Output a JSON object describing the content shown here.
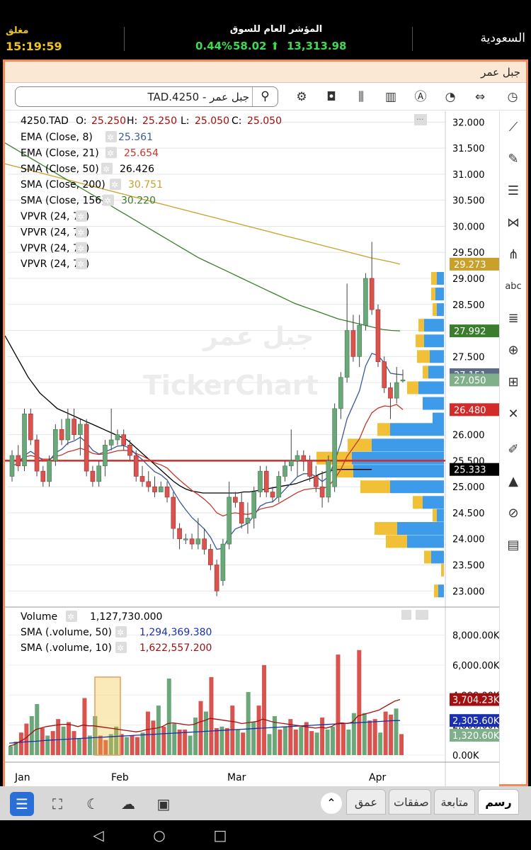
{
  "ticker": {
    "status": "مغلق",
    "time": "15:19:59",
    "index_title": "المؤشر العام للسوق",
    "change_pct": "0.44%",
    "change_pts": "58.02",
    "index_value": "13,313.98",
    "market": "السعودية"
  },
  "header": {
    "company": "جبل عمر"
  },
  "search": {
    "value": "TAD.4250 - جبل عمر"
  },
  "watermark": {
    "company": "جبل عمر",
    "brand": "TickerChart"
  },
  "legend": {
    "ohlc": {
      "symbol": "4250.TAD",
      "o_label": "O:",
      "o": "25.250",
      "h_label": "H:",
      "h": "25.250",
      "l_label": "L:",
      "l": "25.050",
      "c_label": "C:",
      "c": "25.050"
    },
    "indicators": [
      {
        "label": "EMA (Close, 8)",
        "value": "25.361",
        "color": "#3b5998"
      },
      {
        "label": "EMA (Close, 21)",
        "value": "25.654",
        "color": "#c0392b"
      },
      {
        "label": "SMA (Close, 50)",
        "value": "26.426",
        "color": "#000000"
      },
      {
        "label": "SMA (Close, 200)",
        "value": "30.751",
        "color": "#c8a02a"
      },
      {
        "label": "SMA (Close, 156)",
        "value": "30.220",
        "color": "#3a7d2c"
      },
      {
        "label": "VPVR (24, 70)",
        "value": "",
        "color": "#000000"
      },
      {
        "label": "VPVR (24, 70)",
        "value": "",
        "color": "#000000"
      },
      {
        "label": "VPVR (24, 70)",
        "value": "",
        "color": "#000000"
      },
      {
        "label": "VPVR (24, 70)",
        "value": "",
        "color": "#000000"
      }
    ]
  },
  "volume_legend": [
    {
      "label": "Volume",
      "value": "1,127,730.000",
      "color": "#000000"
    },
    {
      "label": "SMA (.volume, 50)",
      "value": "1,294,369.380",
      "color": "#1a2fb0"
    },
    {
      "label": "SMA (.volume, 10)",
      "value": "1,622,557.200",
      "color": "#a01010"
    }
  ],
  "price_axis": [
    "32.000",
    "31.500",
    "31.000",
    "30.500",
    "30.000",
    "29.500",
    "29.000",
    "28.500",
    "28.000",
    "27.500",
    "27.000",
    "26.500",
    "26.000",
    "25.500",
    "25.000",
    "24.500",
    "24.000",
    "23.500",
    "23.000"
  ],
  "price_tags": [
    {
      "text": "29.273",
      "value": 29.273,
      "bg": "#c8a02a"
    },
    {
      "text": "27.992",
      "value": 27.992,
      "bg": "#3a7d2c"
    },
    {
      "text": "27.151",
      "value": 27.151,
      "bg": "#5c6b8a"
    },
    {
      "text": "27.050",
      "value": 27.05,
      "bg": "#7fb08a"
    },
    {
      "text": "26.480",
      "value": 26.48,
      "bg": "#d42a2a"
    },
    {
      "text": "25.333",
      "value": 25.333,
      "bg": "#000000"
    }
  ],
  "volume_axis": [
    "8,000.00K",
    "6,000.00K",
    "4,000.00K",
    "2,000.00K",
    "0.00K"
  ],
  "volume_tags": [
    {
      "text": "3,704.23K",
      "value": 3704.23,
      "bg": "#a01010"
    },
    {
      "text": "2,305.60K",
      "value": 2305.6,
      "bg": "#1a2fb0"
    },
    {
      "text": "1,320.60K",
      "value": 1320.6,
      "bg": "#7fb08a"
    }
  ],
  "x_axis": [
    "Jan",
    "Feb",
    "Mar",
    "Apr"
  ],
  "chart_data": {
    "type": "candlestick",
    "price_range": [
      22.8,
      32.1
    ],
    "volume_range_k": [
      0,
      8500
    ],
    "horizontal_line": 25.5,
    "candles": [
      [
        25.2,
        25.7,
        25.1,
        25.6
      ],
      [
        25.6,
        25.8,
        25.3,
        25.4
      ],
      [
        25.4,
        26.5,
        25.3,
        26.4
      ],
      [
        26.4,
        26.5,
        25.8,
        25.9
      ],
      [
        25.9,
        26.0,
        25.2,
        25.3
      ],
      [
        25.3,
        25.4,
        25.0,
        25.1
      ],
      [
        25.1,
        25.6,
        25.0,
        25.5
      ],
      [
        25.5,
        26.2,
        25.4,
        26.1
      ],
      [
        26.1,
        26.3,
        25.8,
        25.9
      ],
      [
        25.9,
        26.5,
        25.8,
        26.3
      ],
      [
        26.3,
        26.5,
        25.9,
        26.0
      ],
      [
        26.0,
        26.3,
        25.6,
        26.2
      ],
      [
        26.2,
        26.3,
        25.2,
        25.3
      ],
      [
        25.3,
        25.4,
        25.0,
        25.1
      ],
      [
        25.1,
        25.5,
        25.0,
        25.4
      ],
      [
        25.4,
        25.9,
        25.2,
        25.8
      ],
      [
        25.8,
        26.5,
        25.7,
        25.9
      ],
      [
        25.9,
        26.1,
        25.8,
        26.0
      ],
      [
        26.0,
        26.1,
        25.7,
        25.8
      ],
      [
        25.8,
        25.9,
        25.5,
        25.6
      ],
      [
        25.6,
        25.7,
        25.1,
        25.2
      ],
      [
        25.2,
        25.4,
        25.0,
        25.1
      ],
      [
        25.1,
        25.3,
        24.9,
        25.0
      ],
      [
        25.0,
        25.2,
        24.8,
        24.9
      ],
      [
        24.9,
        25.1,
        24.9,
        25.0
      ],
      [
        25.0,
        25.1,
        24.7,
        24.8
      ],
      [
        24.8,
        24.9,
        24.0,
        24.2
      ],
      [
        24.2,
        24.3,
        23.8,
        24.0
      ],
      [
        24.0,
        24.1,
        23.9,
        24.0
      ],
      [
        24.0,
        24.1,
        23.8,
        23.9
      ],
      [
        23.9,
        24.4,
        23.8,
        24.0
      ],
      [
        24.0,
        24.2,
        23.7,
        23.8
      ],
      [
        23.8,
        23.9,
        23.4,
        23.5
      ],
      [
        23.5,
        23.6,
        22.9,
        23.0
      ],
      [
        23.2,
        24.0,
        23.1,
        23.9
      ],
      [
        23.9,
        25.1,
        23.8,
        24.8
      ],
      [
        24.8,
        24.9,
        24.6,
        24.7
      ],
      [
        24.7,
        24.9,
        24.2,
        24.3
      ],
      [
        24.3,
        24.7,
        24.1,
        24.4
      ],
      [
        24.4,
        25.0,
        24.2,
        24.9
      ],
      [
        24.9,
        25.4,
        24.8,
        25.3
      ],
      [
        25.3,
        25.4,
        24.8,
        24.9
      ],
      [
        24.9,
        25.0,
        24.7,
        24.8
      ],
      [
        24.8,
        25.3,
        24.7,
        25.2
      ],
      [
        25.2,
        25.5,
        25.1,
        25.4
      ],
      [
        25.4,
        26.1,
        25.3,
        25.5
      ],
      [
        25.5,
        25.7,
        25.2,
        25.6
      ],
      [
        25.6,
        25.7,
        25.3,
        25.5
      ],
      [
        25.5,
        25.6,
        25.1,
        25.2
      ],
      [
        25.2,
        25.4,
        24.9,
        25.0
      ],
      [
        25.0,
        25.3,
        24.6,
        24.8
      ],
      [
        24.8,
        25.6,
        24.7,
        25.5
      ],
      [
        25.0,
        26.6,
        24.9,
        26.5
      ],
      [
        26.5,
        27.2,
        26.3,
        27.1
      ],
      [
        27.1,
        28.9,
        27.0,
        28.0
      ],
      [
        28.0,
        28.3,
        27.4,
        27.5
      ],
      [
        27.5,
        28.3,
        27.3,
        28.1
      ],
      [
        28.1,
        29.1,
        28.0,
        29.0
      ],
      [
        29.0,
        29.7,
        28.3,
        28.4
      ],
      [
        28.4,
        28.5,
        27.3,
        27.4
      ],
      [
        27.4,
        27.5,
        26.8,
        26.9
      ],
      [
        26.9,
        27.0,
        26.3,
        26.7
      ],
      [
        26.7,
        27.3,
        26.6,
        27.0
      ],
      [
        27.05,
        27.25,
        27.0,
        27.05
      ]
    ],
    "volumes_k": [
      600,
      900,
      1500,
      2100,
      2600,
      3400,
      1800,
      1300,
      1600,
      2400,
      1900,
      2200,
      1600,
      1100,
      3800,
      1300,
      2600,
      1300,
      1000,
      1400,
      1900,
      1400,
      1200,
      1300,
      1200,
      1500,
      2900,
      2300,
      3300,
      1900,
      5100,
      2100,
      1700,
      1700,
      1300,
      2500,
      3600,
      2900,
      5200,
      1800,
      1900,
      1800,
      3300,
      1700,
      1500,
      4200,
      2200,
      3300,
      6000,
      1400,
      2600,
      1700,
      1900,
      2400,
      1700,
      1900,
      2200,
      1600,
      1500,
      2500,
      1700,
      1900,
      6700,
      2100,
      1700,
      2800,
      7000,
      2800,
      2300,
      2400,
      1500,
      2900,
      2700,
      3100,
      1400
    ],
    "ema8": [
      25.4,
      25.45,
      25.6,
      25.68,
      25.6,
      25.5,
      25.5,
      25.65,
      25.72,
      25.84,
      25.88,
      25.95,
      25.85,
      25.7,
      25.63,
      25.67,
      25.72,
      25.78,
      25.79,
      25.74,
      25.62,
      25.52,
      25.4,
      25.29,
      25.23,
      25.13,
      24.92,
      24.72,
      24.56,
      24.41,
      24.3,
      24.19,
      24.03,
      23.8,
      23.82,
      24.04,
      24.19,
      24.24,
      24.3,
      24.44,
      24.63,
      24.69,
      24.71,
      24.82,
      24.95,
      25.07,
      25.19,
      25.25,
      25.25,
      25.2,
      25.1,
      25.19,
      25.48,
      25.84,
      26.3,
      26.57,
      26.84,
      27.32,
      27.56,
      27.52,
      27.38,
      27.18,
      27.16,
      27.151
    ],
    "ema21": [
      25.5,
      25.5,
      25.57,
      25.6,
      25.57,
      25.53,
      25.53,
      25.58,
      25.61,
      25.67,
      25.7,
      25.74,
      25.7,
      25.64,
      25.62,
      25.63,
      25.66,
      25.69,
      25.7,
      25.69,
      25.64,
      25.59,
      25.53,
      25.46,
      25.42,
      25.36,
      25.24,
      25.13,
      25.03,
      24.93,
      24.85,
      24.76,
      24.65,
      24.5,
      24.44,
      24.48,
      24.5,
      24.48,
      24.47,
      24.5,
      24.57,
      24.6,
      24.62,
      24.68,
      24.75,
      24.82,
      24.89,
      24.94,
      24.96,
      24.97,
      24.96,
      25.01,
      25.15,
      25.33,
      25.58,
      25.75,
      25.92,
      26.2,
      26.42,
      26.51,
      26.55,
      26.54,
      26.58,
      26.48
    ],
    "sma50": [
      27.9,
      27.7,
      27.5,
      27.3,
      27.1,
      26.95,
      26.8,
      26.7,
      26.6,
      26.5,
      26.45,
      26.4,
      26.35,
      26.3,
      26.25,
      26.2,
      26.15,
      26.1,
      26.05,
      26.0,
      25.95,
      25.9,
      25.8,
      25.7,
      25.6,
      25.5,
      25.4,
      25.3,
      25.2,
      25.1,
      25.02,
      24.96,
      24.92,
      24.9,
      24.88,
      24.88,
      24.88,
      24.88,
      24.88,
      24.88,
      24.88,
      24.9,
      24.9,
      24.92,
      24.94,
      24.96,
      24.98,
      25.0,
      25.02,
      25.04,
      25.06,
      25.1,
      25.14,
      25.18,
      25.24,
      25.28,
      25.31,
      25.33,
      25.333,
      25.333,
      25.333,
      25.333,
      25.333,
      25.333
    ],
    "sma156": [
      31.6,
      31.5,
      31.4,
      31.3,
      31.2,
      31.1,
      31.0,
      30.9,
      30.8,
      30.7,
      30.6,
      30.5,
      30.4,
      30.3,
      30.2,
      30.1,
      30.0,
      29.9,
      29.8,
      29.7,
      29.6,
      29.5,
      29.4,
      29.32,
      29.24,
      29.16,
      29.08,
      29.0,
      28.92,
      28.84,
      28.76,
      28.68,
      28.6,
      28.52,
      28.46,
      28.4,
      28.34,
      28.28,
      28.22,
      28.18,
      28.14,
      28.1,
      28.06,
      28.02,
      28.0,
      27.992
    ],
    "sma200": [
      31.2,
      31.15,
      31.1,
      31.05,
      31.0,
      30.95,
      30.9,
      30.85,
      30.8,
      30.75,
      30.7,
      30.65,
      30.6,
      30.55,
      30.5,
      30.45,
      30.4,
      30.35,
      30.3,
      30.25,
      30.2,
      30.15,
      30.1,
      30.05,
      30.0,
      29.95,
      29.9,
      29.85,
      29.8,
      29.75,
      29.7,
      29.65,
      29.6,
      29.55,
      29.5,
      29.45,
      29.4,
      29.36,
      29.32,
      29.273
    ],
    "vpvr": [
      {
        "price": 29.0,
        "up": 10,
        "down": 8
      },
      {
        "price": 28.7,
        "up": 12,
        "down": 6
      },
      {
        "price": 28.4,
        "up": 10,
        "down": 6
      },
      {
        "price": 28.1,
        "up": 28,
        "down": 8
      },
      {
        "price": 27.8,
        "up": 28,
        "down": 12
      },
      {
        "price": 27.5,
        "up": 20,
        "down": 18
      },
      {
        "price": 27.2,
        "up": 22,
        "down": 8
      },
      {
        "price": 26.9,
        "up": 36,
        "down": 16
      },
      {
        "price": 26.6,
        "up": 30,
        "down": 0
      },
      {
        "price": 26.3,
        "up": 16,
        "down": 0
      },
      {
        "price": 26.1,
        "up": 76,
        "down": 18
      },
      {
        "price": 25.8,
        "up": 102,
        "down": 34
      },
      {
        "price": 25.55,
        "up": 130,
        "down": 50
      },
      {
        "price": 25.3,
        "up": 128,
        "down": 26
      },
      {
        "price": 25.0,
        "up": 76,
        "down": 42
      },
      {
        "price": 24.7,
        "up": 30,
        "down": 14
      },
      {
        "price": 24.45,
        "up": 10,
        "down": 6
      },
      {
        "price": 24.2,
        "up": 66,
        "down": 32
      },
      {
        "price": 23.95,
        "up": 52,
        "down": 30
      },
      {
        "price": 23.65,
        "up": 18,
        "down": 10
      },
      {
        "price": 23.4,
        "up": 0,
        "down": 4
      },
      {
        "price": 23.0,
        "up": 8,
        "down": 6
      }
    ],
    "vol_sma10": [
      600,
      700,
      900,
      1100,
      1400,
      1700,
      1800,
      1900,
      1950,
      2000,
      2050,
      2050,
      2000,
      1900,
      2000,
      1950,
      1950,
      1900,
      1850,
      1800,
      1750,
      1700,
      1650,
      1600,
      1550,
      1600,
      1700,
      1750,
      1800,
      1900,
      2100,
      2150,
      2100,
      2050,
      2000,
      2050,
      2200,
      2300,
      2450,
      2400,
      2350,
      2300,
      2250,
      2200,
      2100,
      2150,
      2200,
      2250,
      2400,
      2300,
      2200,
      2150,
      2100,
      2050,
      2000,
      1950,
      1900,
      1850,
      1800,
      1850,
      1800,
      1900,
      2100,
      2150,
      2100,
      2200,
      2600,
      2700,
      2800,
      2900,
      3000,
      3200,
      3400,
      3600,
      3704.23
    ],
    "vol_sma50": [
      800,
      820,
      850,
      880,
      900,
      920,
      950,
      980,
      1000,
      1020,
      1040,
      1060,
      1080,
      1100,
      1120,
      1140,
      1160,
      1180,
      1200,
      1220,
      1240,
      1260,
      1280,
      1300,
      1320,
      1340,
      1360,
      1380,
      1400,
      1420,
      1440,
      1460,
      1480,
      1500,
      1520,
      1540,
      1560,
      1580,
      1600,
      1620,
      1640,
      1660,
      1680,
      1700,
      1720,
      1740,
      1760,
      1780,
      1800,
      1820,
      1840,
      1860,
      1880,
      1900,
      1920,
      1940,
      1960,
      1980,
      2000,
      2020,
      2040,
      2060,
      2080,
      2100,
      2120,
      2140,
      2160,
      2180,
      2200,
      2220,
      2240,
      2260,
      2280,
      2300,
      2305.6
    ]
  },
  "bottom_tabs": [
    "رسم",
    "متابعة",
    "صفقات",
    "عمق"
  ]
}
